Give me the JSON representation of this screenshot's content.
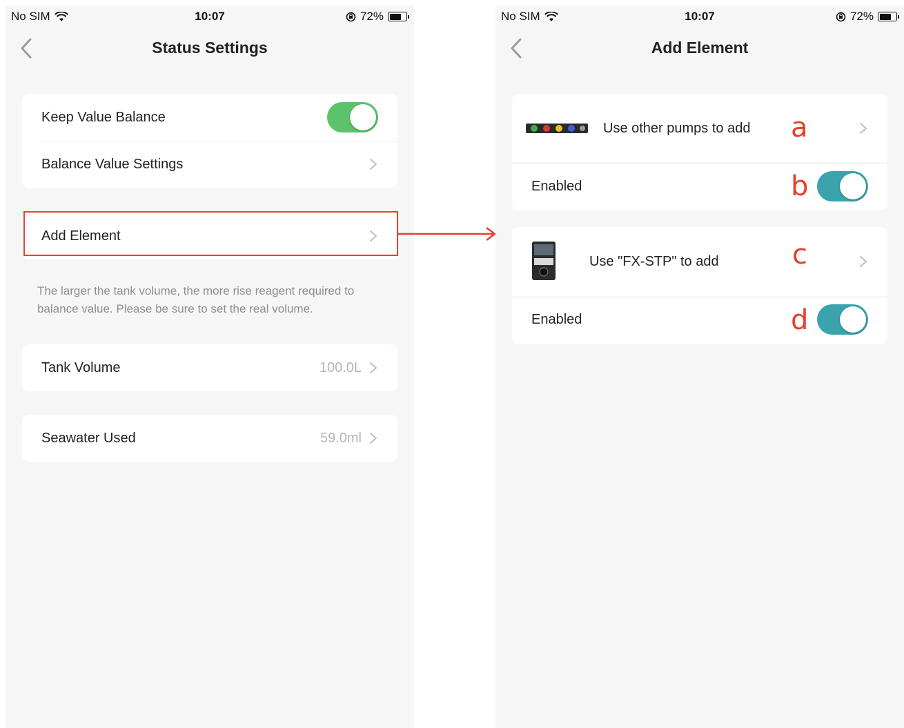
{
  "status_bar": {
    "carrier": "No SIM",
    "time": "10:07",
    "battery": "72%",
    "battery_level": 0.72
  },
  "left_screen": {
    "title": "Status Settings",
    "balance_card": {
      "keep_value_balance_label": "Keep Value Balance",
      "keep_value_balance_on": true,
      "balance_value_settings_label": "Balance Value Settings"
    },
    "add_element_label": "Add Element",
    "hint_text": "The larger the tank volume, the more rise reagent required to balance value. Please be sure to set the real volume.",
    "tank_volume": {
      "label": "Tank Volume",
      "value": "100.0L"
    },
    "seawater_used": {
      "label": "Seawater Used",
      "value": "59.0ml"
    }
  },
  "right_screen": {
    "title": "Add Element",
    "option_a": {
      "label": "Use other pumps to add",
      "marker": "a"
    },
    "enabled_b": {
      "label": "Enabled",
      "marker": "b",
      "on": true
    },
    "option_c": {
      "label": "Use \"FX-STP\" to add",
      "marker": "c"
    },
    "enabled_d": {
      "label": "Enabled",
      "marker": "d",
      "on": true
    }
  },
  "colors": {
    "toggle_green": "#5cc36a",
    "toggle_teal": "#3aa3ac",
    "annotation_red": "#e8402a",
    "page_bg": "#f6f6f6"
  },
  "icons": [
    "wifi-icon",
    "orientation-lock-icon",
    "battery-icon",
    "back-chevron-icon",
    "chevron-right-icon"
  ]
}
